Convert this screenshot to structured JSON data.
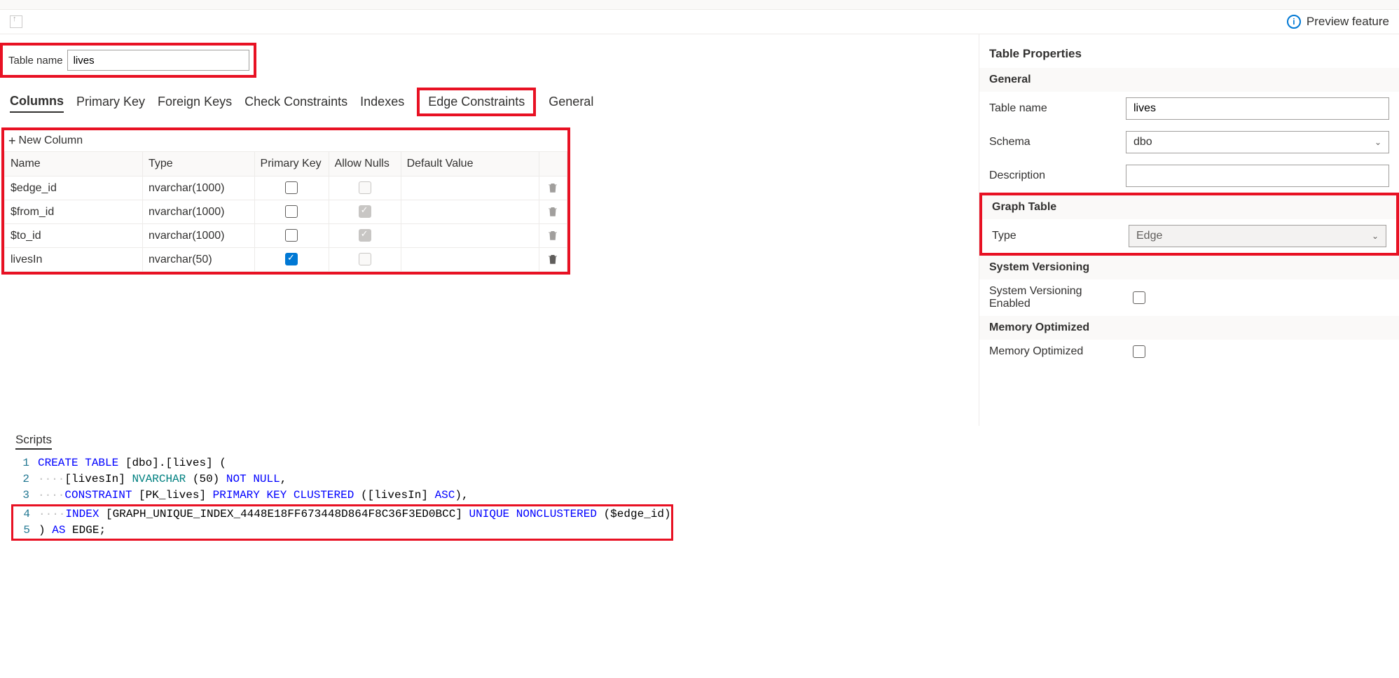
{
  "header": {
    "preview_label": "Preview feature"
  },
  "toolbar": {
    "table_name_label": "Table name",
    "table_name_value": "lives"
  },
  "tabs": {
    "columns": "Columns",
    "primary_key": "Primary Key",
    "foreign_keys": "Foreign Keys",
    "check_constraints": "Check Constraints",
    "indexes": "Indexes",
    "edge_constraints": "Edge Constraints",
    "general": "General"
  },
  "columns_panel": {
    "new_column": "New Column",
    "headers": {
      "name": "Name",
      "type": "Type",
      "pk": "Primary Key",
      "nulls": "Allow Nulls",
      "default": "Default Value"
    },
    "rows": [
      {
        "name": "$edge_id",
        "type": "nvarchar(1000)",
        "pk": false,
        "nulls": "unchecked-disabled",
        "default": ""
      },
      {
        "name": "$from_id",
        "type": "nvarchar(1000)",
        "pk": false,
        "nulls": "checked-gray",
        "default": ""
      },
      {
        "name": "$to_id",
        "type": "nvarchar(1000)",
        "pk": false,
        "nulls": "checked-gray",
        "default": ""
      },
      {
        "name": "livesIn",
        "type": "nvarchar(50)",
        "pk": true,
        "nulls": "unchecked-disabled",
        "default": ""
      }
    ]
  },
  "properties": {
    "title": "Table Properties",
    "general": {
      "header": "General",
      "table_name_label": "Table name",
      "table_name_value": "lives",
      "schema_label": "Schema",
      "schema_value": "dbo",
      "description_label": "Description",
      "description_value": ""
    },
    "graph": {
      "header": "Graph Table",
      "type_label": "Type",
      "type_value": "Edge"
    },
    "system_versioning": {
      "header": "System Versioning",
      "enabled_label": "System Versioning Enabled"
    },
    "memory_optimized": {
      "header": "Memory Optimized",
      "label": "Memory Optimized"
    }
  },
  "scripts": {
    "title": "Scripts",
    "lines": [
      {
        "n": "1",
        "tokens": [
          [
            "kw",
            "CREATE"
          ],
          [
            "sp",
            " "
          ],
          [
            "kw",
            "TABLE"
          ],
          [
            "sp",
            " "
          ],
          [
            "id",
            "[dbo].[lives]"
          ],
          [
            "sp",
            " "
          ],
          [
            "id",
            "("
          ]
        ]
      },
      {
        "n": "2",
        "tokens": [
          [
            "gray",
            "····"
          ],
          [
            "id",
            "[livesIn]"
          ],
          [
            "sp",
            " "
          ],
          [
            "sys",
            "NVARCHAR"
          ],
          [
            "sp",
            " "
          ],
          [
            "id",
            "("
          ],
          [
            "id",
            "50"
          ],
          [
            "id",
            ")"
          ],
          [
            "sp",
            " "
          ],
          [
            "kw",
            "NOT"
          ],
          [
            "sp",
            " "
          ],
          [
            "kw",
            "NULL"
          ],
          [
            "id",
            ","
          ]
        ]
      },
      {
        "n": "3",
        "tokens": [
          [
            "gray",
            "····"
          ],
          [
            "kw",
            "CONSTRAINT"
          ],
          [
            "sp",
            " "
          ],
          [
            "id",
            "[PK_lives]"
          ],
          [
            "sp",
            " "
          ],
          [
            "kw",
            "PRIMARY"
          ],
          [
            "sp",
            " "
          ],
          [
            "kw",
            "KEY"
          ],
          [
            "sp",
            " "
          ],
          [
            "kw",
            "CLUSTERED"
          ],
          [
            "sp",
            " "
          ],
          [
            "id",
            "([livesIn]"
          ],
          [
            "sp",
            " "
          ],
          [
            "kw",
            "ASC"
          ],
          [
            "id",
            ")"
          ],
          [
            "id",
            ","
          ]
        ]
      },
      {
        "n": "4",
        "tokens": [
          [
            "gray",
            "····"
          ],
          [
            "kw",
            "INDEX"
          ],
          [
            "sp",
            " "
          ],
          [
            "id",
            "[GRAPH_UNIQUE_INDEX_4448E18FF673448D864F8C36F3ED0BCC]"
          ],
          [
            "sp",
            " "
          ],
          [
            "kw",
            "UNIQUE"
          ],
          [
            "sp",
            " "
          ],
          [
            "kw",
            "NONCLUSTERED"
          ],
          [
            "sp",
            " "
          ],
          [
            "id",
            "($edge_id)"
          ]
        ]
      },
      {
        "n": "5",
        "tokens": [
          [
            "id",
            ")"
          ],
          [
            "sp",
            " "
          ],
          [
            "kw",
            "AS"
          ],
          [
            "sp",
            " "
          ],
          [
            "id",
            "EDGE;"
          ]
        ]
      }
    ]
  }
}
